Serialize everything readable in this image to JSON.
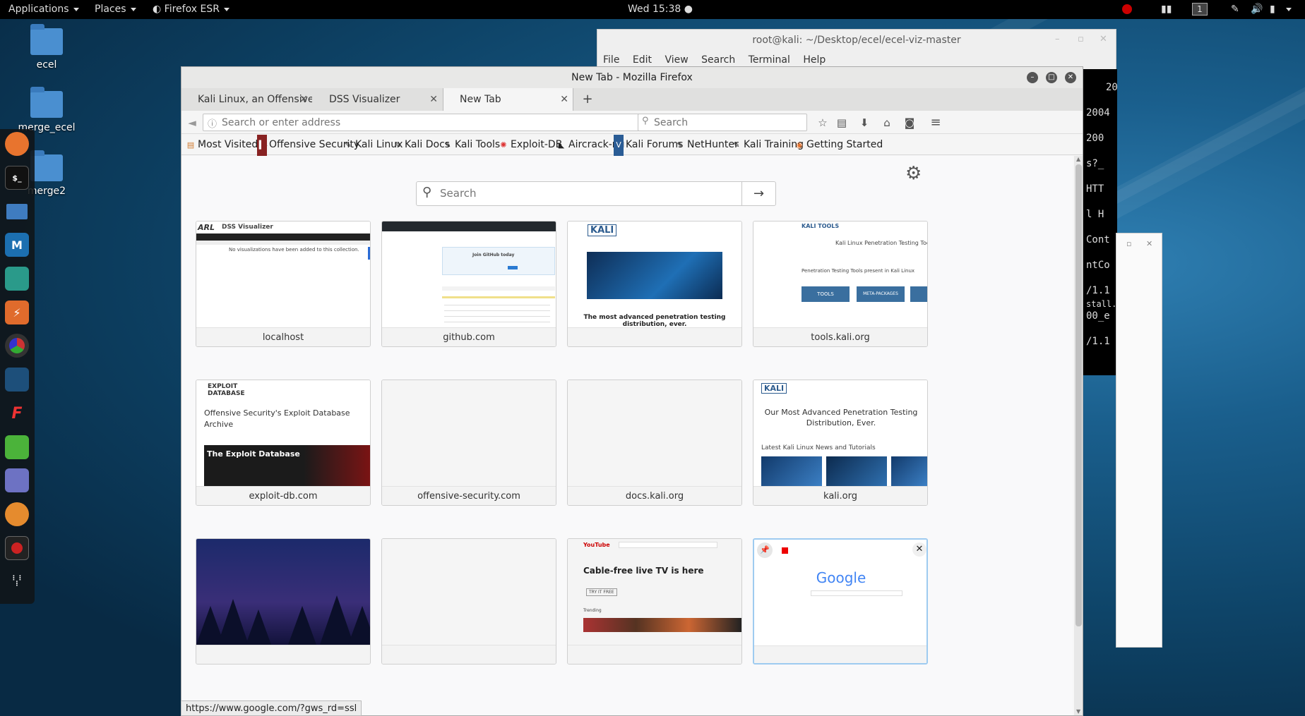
{
  "topbar": {
    "applications": "Applications",
    "places": "Places",
    "app_menu": "Firefox ESR",
    "clock": "Wed 15:38 ●",
    "workspace": "1"
  },
  "desktop": {
    "icons": [
      {
        "label": "ecel"
      },
      {
        "label": "merge_ecel"
      },
      {
        "label": "merge2"
      }
    ]
  },
  "dock": {
    "items": [
      {
        "name": "firefox-icon"
      },
      {
        "name": "terminal-icon",
        "glyph": "$_"
      },
      {
        "name": "files-icon"
      },
      {
        "name": "metasploit-icon",
        "glyph": "M"
      },
      {
        "name": "armitage-icon"
      },
      {
        "name": "burpsuite-icon",
        "glyph": "⚡"
      },
      {
        "name": "beef-icon"
      },
      {
        "name": "maltego-icon"
      },
      {
        "name": "faraday-icon",
        "glyph": "F"
      },
      {
        "name": "leafpad-icon"
      },
      {
        "name": "notes-icon"
      },
      {
        "name": "zenmap-icon"
      },
      {
        "name": "recorder-icon"
      },
      {
        "name": "show-apps-icon",
        "glyph": "⋮⋮⋮"
      }
    ]
  },
  "terminal": {
    "title": "root@kali: ~/Desktop/ecel/ecel-viz-master",
    "menu": [
      "File",
      "Edit",
      "View",
      "Search",
      "Terminal",
      "Help"
    ],
    "visible_text": [
      "20",
      "2004",
      "200",
      "s?_",
      "HTT",
      "l H",
      "Cont",
      "ntCo",
      "/1.1",
      "stall.",
      "00_e",
      "/1.1"
    ]
  },
  "firefox": {
    "window_title": "New Tab - Mozilla Firefox",
    "tabs": [
      {
        "label": "Kali Linux, an Offensive S..."
      },
      {
        "label": "DSS Visualizer"
      },
      {
        "label": "New Tab"
      }
    ],
    "url_placeholder": "Search or enter address",
    "search_placeholder": "Search",
    "bookmarks": [
      {
        "label": "Most Visited",
        "icon": "⚙"
      },
      {
        "label": "Offensive Security"
      },
      {
        "label": "Kali Linux"
      },
      {
        "label": "Kali Docs"
      },
      {
        "label": "Kali Tools"
      },
      {
        "label": "Exploit-DB"
      },
      {
        "label": "Aircrack-ng"
      },
      {
        "label": "Kali Forums"
      },
      {
        "label": "NetHunter"
      },
      {
        "label": "Kali Training"
      },
      {
        "label": "Getting Started"
      }
    ],
    "newtab": {
      "search_placeholder": "Search",
      "tiles": [
        {
          "label": "localhost",
          "thumb_title": "DSS Visualizer",
          "thumb_text": "No visualizations have been added to this collection.",
          "logo": "ARL"
        },
        {
          "label": "github.com",
          "thumb_text": "Join GitHub today"
        },
        {
          "label": "",
          "logo": "KALI",
          "thumb_text": "The most advanced penetration testing distribution, ever."
        },
        {
          "label": "tools.kali.org",
          "logo": "KALI TOOLS",
          "heading": "Kali Linux Penetration Testing Tools",
          "sub": "Penetration Testing Tools present in Kali Linux",
          "btn1": "TOOLS",
          "btn2": "META-PACKAGES"
        },
        {
          "label": "exploit-db.com",
          "logo": "EXPLOIT DATABASE",
          "heading": "Offensive Security's Exploit Database Archive",
          "banner": "The Exploit Database"
        },
        {
          "label": "offensive-security.com"
        },
        {
          "label": "docs.kali.org"
        },
        {
          "label": "kali.org",
          "logo": "KALI",
          "heading": "Our Most Advanced Penetration Testing Distribution, Ever.",
          "sub": "Latest Kali Linux News and Tutorials"
        },
        {
          "label": ""
        },
        {
          "label": ""
        },
        {
          "label": "",
          "logo": "YouTube",
          "heading": "Cable-free live TV is here",
          "sub": "Trending",
          "btn": "TRY IT FREE"
        },
        {
          "label": "",
          "logo": "Google"
        }
      ]
    },
    "status_url": "https://www.google.com/?gws_rd=ssl"
  }
}
